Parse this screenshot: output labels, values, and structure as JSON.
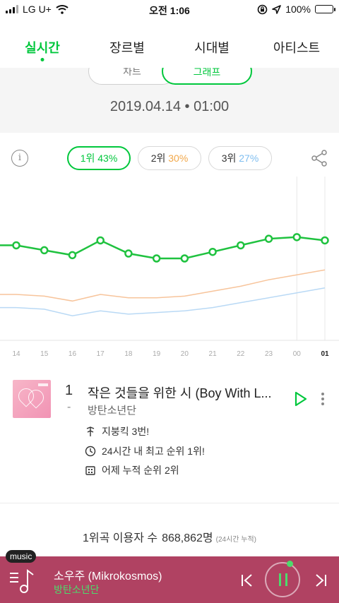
{
  "status_bar": {
    "carrier": "LG U+",
    "time": "오전 1:06",
    "battery": "100%"
  },
  "tabs": [
    {
      "label": "실시간",
      "active": true
    },
    {
      "label": "장르별",
      "active": false
    },
    {
      "label": "시대별",
      "active": false
    },
    {
      "label": "아티스트",
      "active": false
    }
  ],
  "view_toggle": {
    "chart_label": "차트",
    "graph_label": "그래프",
    "selected": "그래프"
  },
  "datetime": "2019.04.14 • 01:00",
  "rank_buttons": [
    {
      "rank": "1위",
      "share": "43%",
      "color": "#00c73c",
      "active": true
    },
    {
      "rank": "2위",
      "share": "30%",
      "color": "#f2a84a",
      "active": false
    },
    {
      "rank": "3위",
      "share": "27%",
      "color": "#7fbef0",
      "active": false
    }
  ],
  "chart_data": {
    "type": "line",
    "x": [
      "14",
      "15",
      "16",
      "17",
      "18",
      "19",
      "20",
      "21",
      "22",
      "23",
      "00",
      "01"
    ],
    "highlight_x": "01",
    "series": [
      {
        "name": "1위",
        "color": "#1fc23f",
        "markers": true,
        "values": [
          58,
          55,
          52,
          61,
          53,
          50,
          50,
          54,
          58,
          62,
          63,
          61
        ]
      },
      {
        "name": "2위",
        "color": "#f7c49b",
        "markers": false,
        "values": [
          28,
          27,
          24,
          28,
          26,
          26,
          27,
          30,
          33,
          37,
          40,
          43
        ]
      },
      {
        "name": "3위",
        "color": "#b9d9f5",
        "markers": false,
        "values": [
          20,
          19,
          15,
          18,
          16,
          17,
          18,
          20,
          23,
          26,
          29,
          32
        ]
      }
    ],
    "ylim": [
      0,
      100
    ]
  },
  "song": {
    "rank": "1",
    "rank_change": "-",
    "title": "작은 것들을 위한 시 (Boy With L...",
    "artist": "방탄소년단",
    "meta": [
      "지붕킥 3번!",
      "24시간 내 최고 순위 1위!",
      "어제 누적 순위 2위"
    ]
  },
  "stats": {
    "label": "1위곡 이용자 수",
    "value": "868,862명",
    "note": "(24시간 누적)"
  },
  "player": {
    "badge": "music",
    "title": "소우주 (Mikrokosmos)",
    "artist": "방탄소년단"
  }
}
